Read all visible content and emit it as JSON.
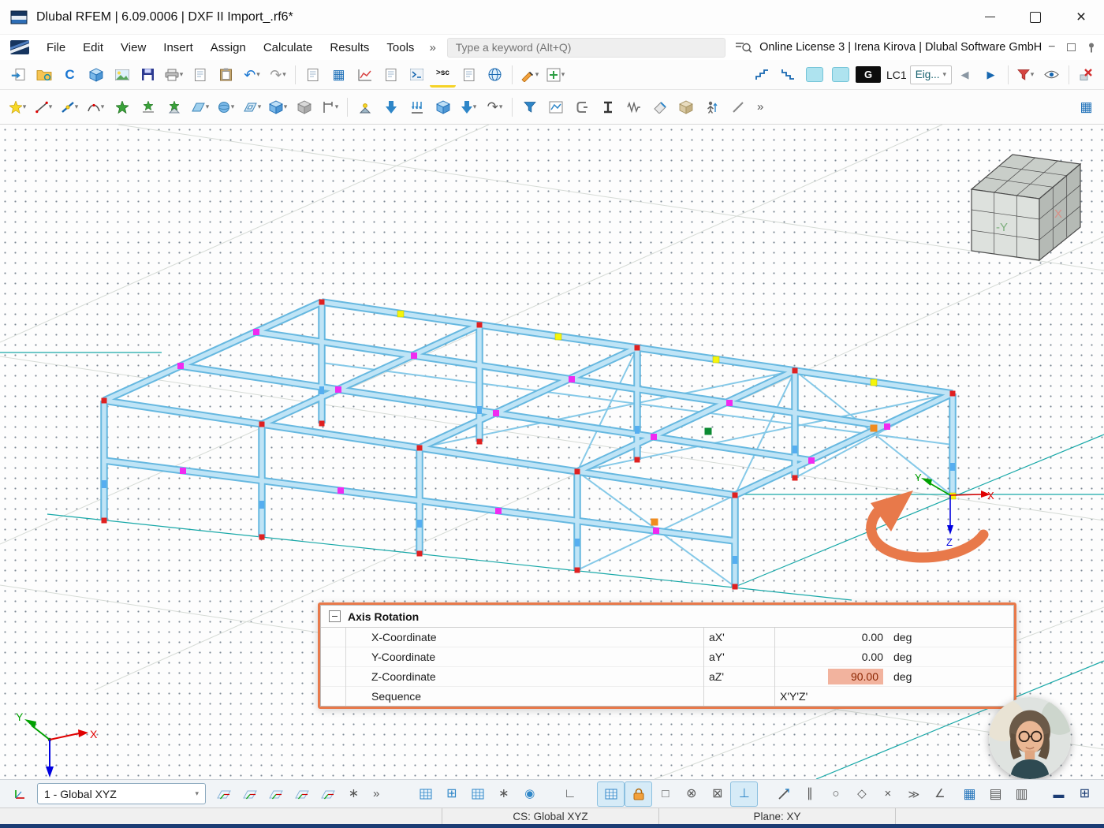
{
  "window": {
    "title": "Dlubal RFEM | 6.09.0006 | DXF II Import_.rf6*"
  },
  "menubar": {
    "items": [
      "File",
      "Edit",
      "View",
      "Insert",
      "Assign",
      "Calculate",
      "Results",
      "Tools"
    ],
    "overflow": "»",
    "search": {
      "placeholder": "Type a keyword (Alt+Q)"
    },
    "license": "Online License 3 | Irena Kirova | Dlubal Software GmbH"
  },
  "toolbar": {
    "g_label": "G",
    "load_case": "LC1",
    "combo": "Eig...",
    "sc_label": ">sc",
    "overflow": "»"
  },
  "viewport": {
    "nav_cube": {
      "front": "-Y",
      "right": "X"
    },
    "triad": {
      "x": "X",
      "y": "Y",
      "z": "Z"
    }
  },
  "axis_rotation": {
    "title": "Axis Rotation",
    "rows": [
      {
        "label": "X-Coordinate",
        "symbol": "aX'",
        "value": "0.00",
        "unit": "deg",
        "highlighted": false
      },
      {
        "label": "Y-Coordinate",
        "symbol": "aY'",
        "value": "0.00",
        "unit": "deg",
        "highlighted": false
      },
      {
        "label": "Z-Coordinate",
        "symbol": "aZ'",
        "value": "90.00",
        "unit": "deg",
        "highlighted": true
      },
      {
        "label": "Sequence",
        "symbol": "",
        "value": "X'Y'Z'",
        "unit": "",
        "highlighted": false
      }
    ]
  },
  "bottombar": {
    "coordinate_system": "1 - Global XYZ",
    "overflow": "»"
  },
  "statusbar": {
    "cs": "CS: Global XYZ",
    "plane": "Plane: XY"
  },
  "colors": {
    "accent_orange": "#E8794A",
    "member_fill": "#BFE4F6",
    "member_edge": "#66B8E0",
    "teal_guide": "#18A8A8",
    "highlight_cell_bg": "#F2B39E",
    "highlight_cell_text": "#8B2500",
    "node_red": "#E02020",
    "node_magenta": "#F02AF0",
    "node_yellow": "#F5F50A",
    "node_green": "#0C8A33",
    "node_orange": "#F08C1E",
    "node_blue": "#56AEF0",
    "axis_x": "#E00000",
    "axis_y": "#00A000",
    "axis_z": "#0000E0"
  }
}
